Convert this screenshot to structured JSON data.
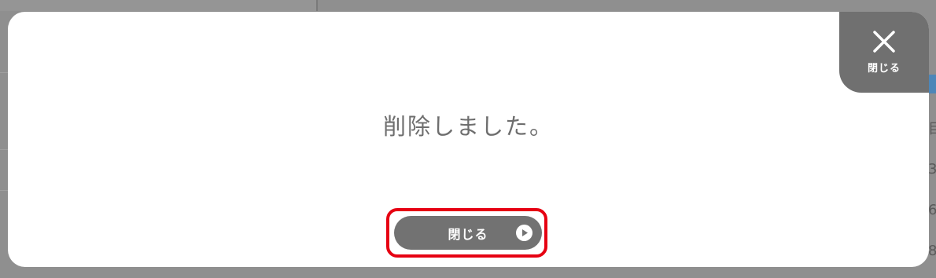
{
  "dialog": {
    "message": "削除しました。",
    "close_button_label": "閉じる",
    "corner_close_label": "閉じる",
    "corner_close_icon": "close-icon",
    "close_button_icon": "play-circle-icon"
  },
  "background_page": {
    "right_edge_fragments": [
      "目",
      "3",
      "6",
      "8"
    ]
  },
  "colors": {
    "overlay": "#8f8f8f",
    "dialog_bg": "#ffffff",
    "button_bg": "#727272",
    "highlight_border": "#e60012",
    "message_text": "#6e6e6e",
    "accent_blue": "#4d86b8"
  }
}
